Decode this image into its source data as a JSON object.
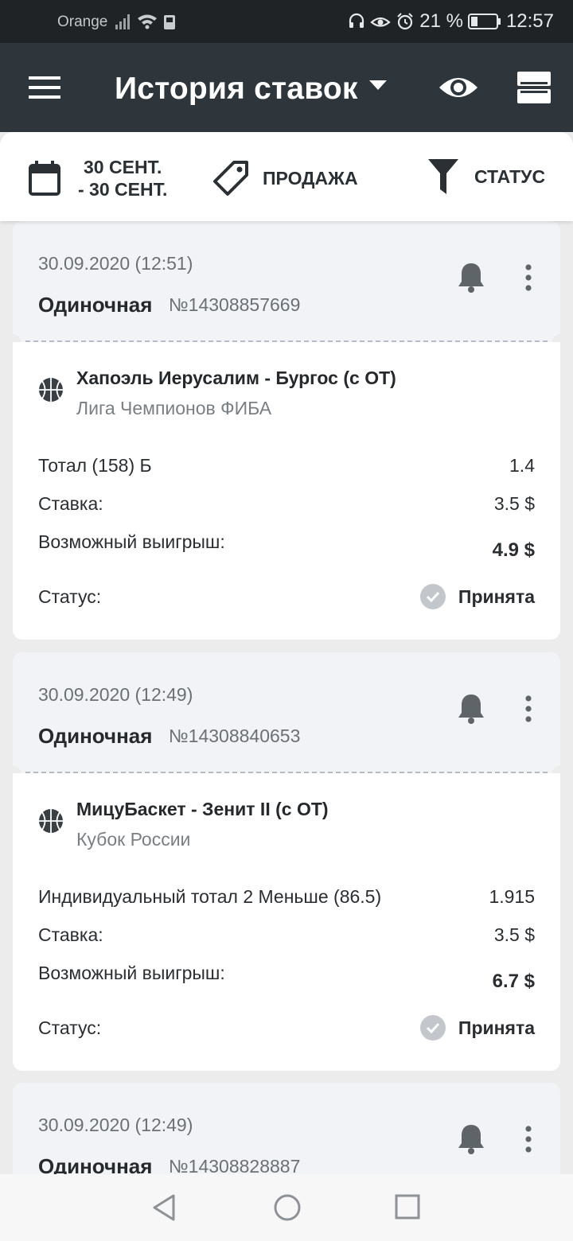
{
  "status_bar": {
    "carrier": "Orange",
    "battery": "21 %",
    "time": "12:57"
  },
  "app_bar": {
    "title": "История ставок"
  },
  "filters": {
    "date_line1": "30 СЕНТ.",
    "date_line2": "- 30 СЕНТ.",
    "sale": "ПРОДАЖА",
    "status": "СТАТУС"
  },
  "bets": [
    {
      "date": "30.09.2020 (12:51)",
      "type": "Одиночная",
      "number": "№14308857669",
      "event": "Хапоэль Иерусалим - Бургос (с ОТ)",
      "league": "Лига Чемпионов ФИБА",
      "market": "Тотал (158) Б",
      "odds": "1.4",
      "stake_label": "Ставка:",
      "stake": "3.5 $",
      "win_label": "Возможный выигрыш:",
      "win": "4.9 $",
      "status_label": "Статус:",
      "status": "Принята"
    },
    {
      "date": "30.09.2020 (12:49)",
      "type": "Одиночная",
      "number": "№14308840653",
      "event": "МицуБаскет - Зенит II (с ОТ)",
      "league": "Кубок России",
      "market": "Индивидуальный тотал 2 Меньше (86.5)",
      "odds": "1.915",
      "stake_label": "Ставка:",
      "stake": "3.5 $",
      "win_label": "Возможный выигрыш:",
      "win": "6.7 $",
      "status_label": "Статус:",
      "status": "Принята"
    },
    {
      "date": "30.09.2020 (12:49)",
      "type": "Одиночная",
      "number": "№14308828887"
    }
  ],
  "colors": {
    "app_bar": "#2e363c",
    "status_bar": "#1f2326",
    "card_head": "#f2f3f7",
    "accepted_check": "#c3c7cc"
  }
}
